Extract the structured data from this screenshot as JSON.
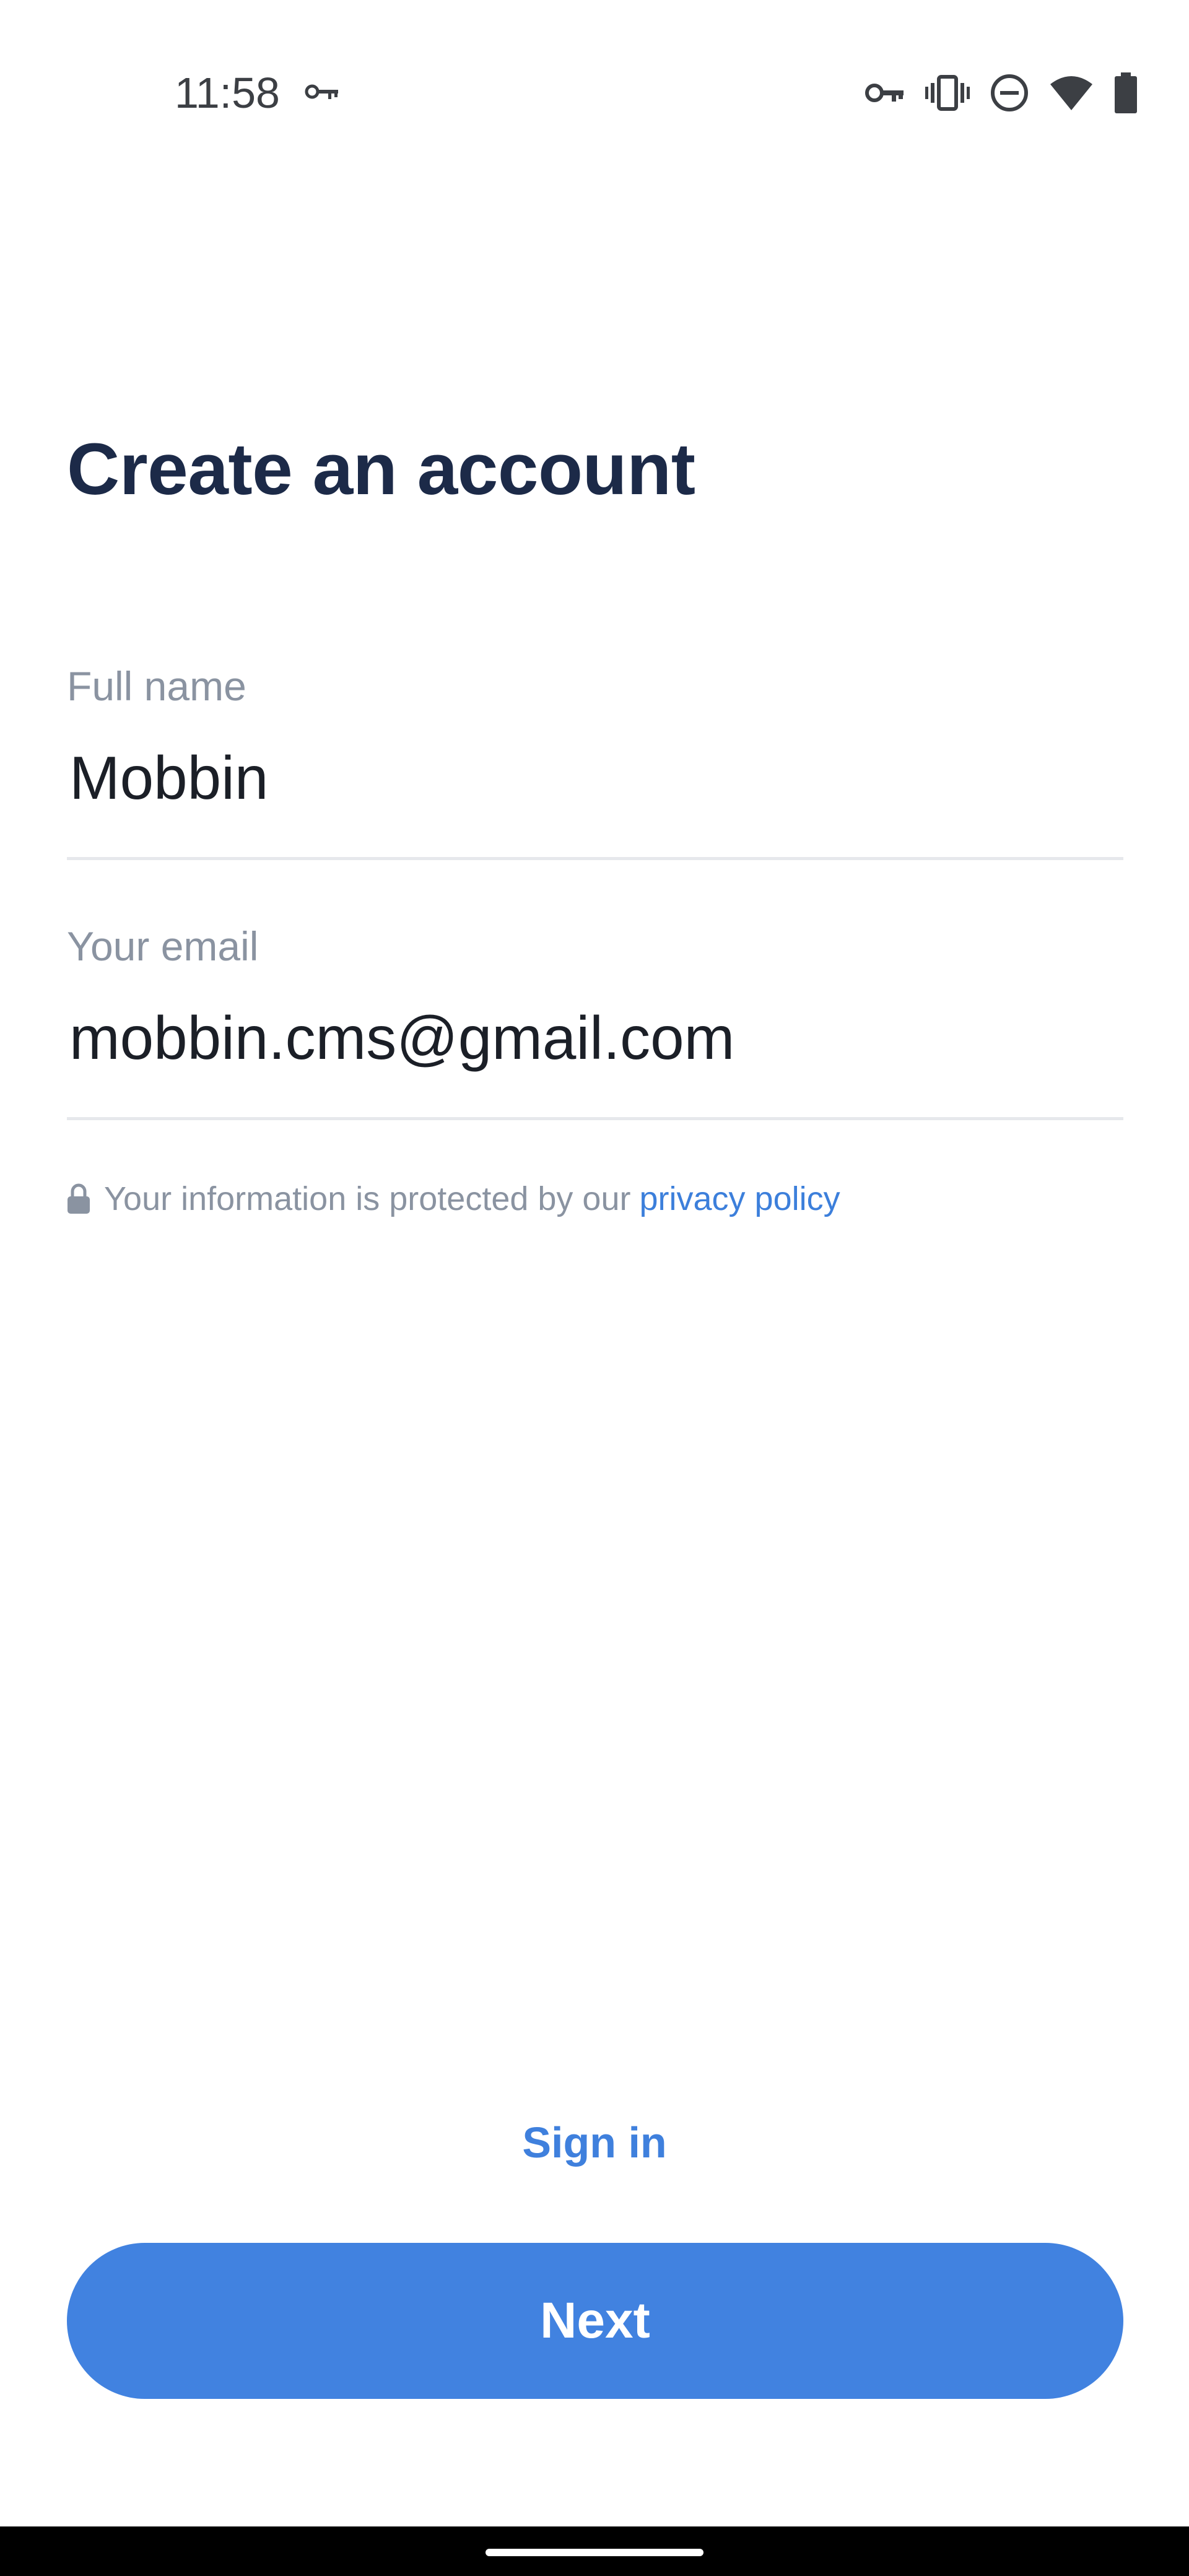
{
  "status_bar": {
    "time": "11:58",
    "icons": [
      "vpn-key-icon",
      "vibrate-icon",
      "do-not-disturb-icon",
      "wifi-icon",
      "battery-icon"
    ]
  },
  "page": {
    "title": "Create an account"
  },
  "form": {
    "full_name": {
      "label": "Full name",
      "value": "Mobbin"
    },
    "email": {
      "label": "Your email",
      "value": "mobbin.cms@gmail.com"
    }
  },
  "privacy": {
    "text": "Your information is protected by our",
    "link": "privacy policy"
  },
  "actions": {
    "sign_in": "Sign in",
    "next": "Next"
  },
  "colors": {
    "title": "#1c2a48",
    "accent": "#4182e0",
    "muted": "#8a93a1",
    "divider": "#e6e8ec"
  }
}
